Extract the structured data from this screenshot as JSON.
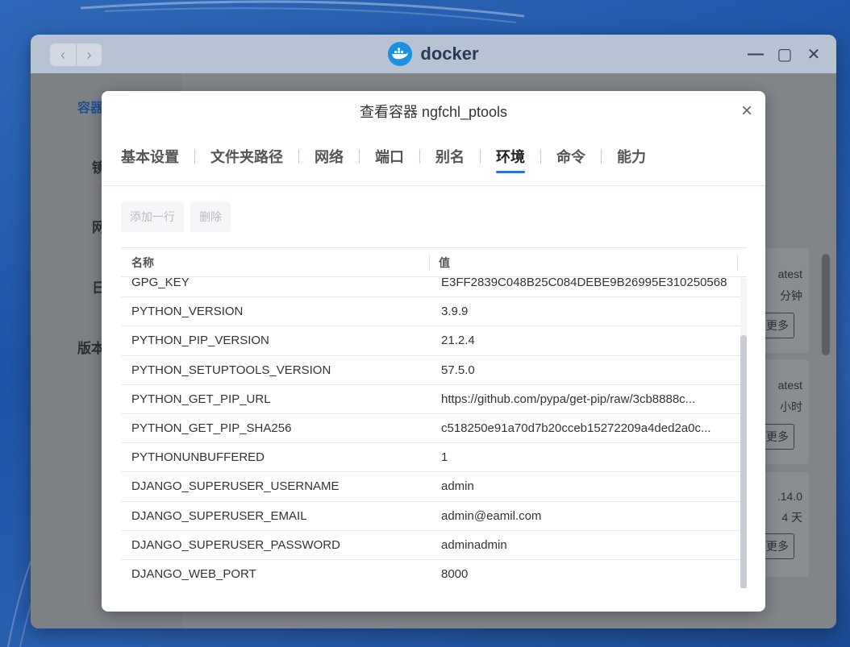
{
  "app": {
    "title": "docker",
    "nav_back": "‹",
    "nav_forward": "›",
    "minimize": "—",
    "maximize": "▢",
    "close": "✕"
  },
  "background": {
    "tab_label": "容器",
    "side_labels": [
      "镜",
      "网",
      "日",
      "版本"
    ],
    "cards": [
      {
        "line1": "atest",
        "line2": "分钟",
        "more": "更多"
      },
      {
        "line1": "atest",
        "line2": "小时",
        "more": "更多"
      },
      {
        "line1": ".14.0",
        "line2": "4 天",
        "more": "更多"
      }
    ]
  },
  "modal": {
    "title": "查看容器 ngfchl_ptools",
    "close": "×",
    "tabs": [
      {
        "label": "基本设置",
        "active": false
      },
      {
        "label": "文件夹路径",
        "active": false
      },
      {
        "label": "网络",
        "active": false
      },
      {
        "label": "端口",
        "active": false
      },
      {
        "label": "别名",
        "active": false
      },
      {
        "label": "环境",
        "active": true
      },
      {
        "label": "命令",
        "active": false
      },
      {
        "label": "能力",
        "active": false
      }
    ],
    "toolbar": {
      "add_row": "添加一行",
      "delete": "删除"
    },
    "table": {
      "col_name": "名称",
      "col_value": "值",
      "rows": [
        {
          "name": "GPG_KEY",
          "value": "E3FF2839C048B25C084DEBE9B26995E310250568"
        },
        {
          "name": "PYTHON_VERSION",
          "value": "3.9.9"
        },
        {
          "name": "PYTHON_PIP_VERSION",
          "value": "21.2.4"
        },
        {
          "name": "PYTHON_SETUPTOOLS_VERSION",
          "value": "57.5.0"
        },
        {
          "name": "PYTHON_GET_PIP_URL",
          "value": "https://github.com/pypa/get-pip/raw/3cb8888c..."
        },
        {
          "name": "PYTHON_GET_PIP_SHA256",
          "value": "c518250e91a70d7b20cceb15272209a4ded2a0c..."
        },
        {
          "name": "PYTHONUNBUFFERED",
          "value": "1"
        },
        {
          "name": "DJANGO_SUPERUSER_USERNAME",
          "value": "admin"
        },
        {
          "name": "DJANGO_SUPERUSER_EMAIL",
          "value": "admin@eamil.com"
        },
        {
          "name": "DJANGO_SUPERUSER_PASSWORD",
          "value": "adminadmin"
        },
        {
          "name": "DJANGO_WEB_PORT",
          "value": "8000"
        }
      ]
    }
  },
  "colors": {
    "accent": "#2d6fdc",
    "desktop": "#2a5fb0",
    "titlebar": "#b7c2d3"
  }
}
